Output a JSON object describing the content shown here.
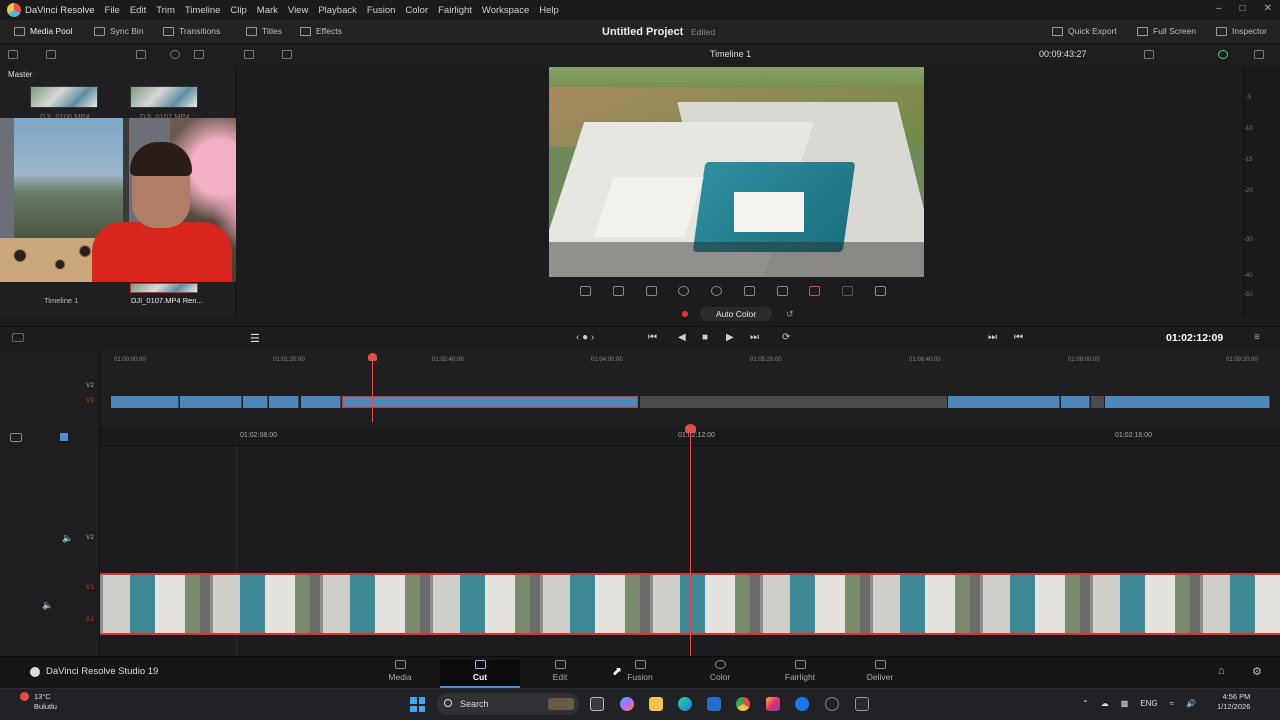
{
  "app": {
    "name": "DaVinci Resolve"
  },
  "menus": [
    "File",
    "Edit",
    "Trim",
    "Timeline",
    "Clip",
    "Mark",
    "View",
    "Playback",
    "Fusion",
    "Color",
    "Fairlight",
    "Workspace",
    "Help"
  ],
  "toolbar": {
    "media_pool": "Media Pool",
    "sync_bin": "Sync Bin",
    "transitions": "Transitions",
    "titles": "Titles",
    "effects": "Effects",
    "project_title": "Untitled Project",
    "project_state": "Edited",
    "quick_export": "Quick Export",
    "full_screen": "Full Screen",
    "inspector": "Inspector"
  },
  "viewer": {
    "timeline_name": "Timeline 1",
    "timecode_top": "00:09:43:27",
    "auto_color": "Auto Color",
    "meter_labels": [
      "-5",
      "-10",
      "-15",
      "-20",
      "-30",
      "-40",
      "-50"
    ]
  },
  "media_pool": {
    "bin": "Master",
    "clips_top": [
      "DJI_0108.MP4",
      "DJI_0107.MP4"
    ],
    "clips_bottom": [
      "Timeline 1",
      "DJI_0107.MP4 Ren..."
    ]
  },
  "transport": {
    "timecode": "01:02:12:09"
  },
  "upper_timeline": {
    "ruler": [
      "01:00:00:00",
      "01:01:20:00",
      "01:02:40:00",
      "01:04:00:00",
      "01:05:20:00",
      "01:06:40:00",
      "01:08:00:00",
      "01:09:20:00"
    ],
    "tracks": [
      "V2",
      "V1"
    ]
  },
  "lower_timeline": {
    "ruler": [
      "01:02:08:00",
      "01:02:12:00",
      "01:02:16:00"
    ],
    "tracks": [
      "V2",
      "V1",
      "A1"
    ]
  },
  "pages": [
    {
      "label": "Media",
      "active": false
    },
    {
      "label": "Cut",
      "active": true
    },
    {
      "label": "Edit",
      "active": false
    },
    {
      "label": "Fusion",
      "active": false
    },
    {
      "label": "Color",
      "active": false
    },
    {
      "label": "Fairlight",
      "active": false
    },
    {
      "label": "Deliver",
      "active": false
    }
  ],
  "brand": "DaVinci Resolve Studio 19",
  "taskbar": {
    "weather_temp": "13°C",
    "weather_desc": "Bulutlu",
    "search_placeholder": "Search",
    "lang": "ENG",
    "time": "4:56 PM",
    "date": "1/12/2026"
  },
  "colors": {
    "accent": "#4c8dd6",
    "playhead": "#e14d4d",
    "clip": "#4e88b8"
  }
}
